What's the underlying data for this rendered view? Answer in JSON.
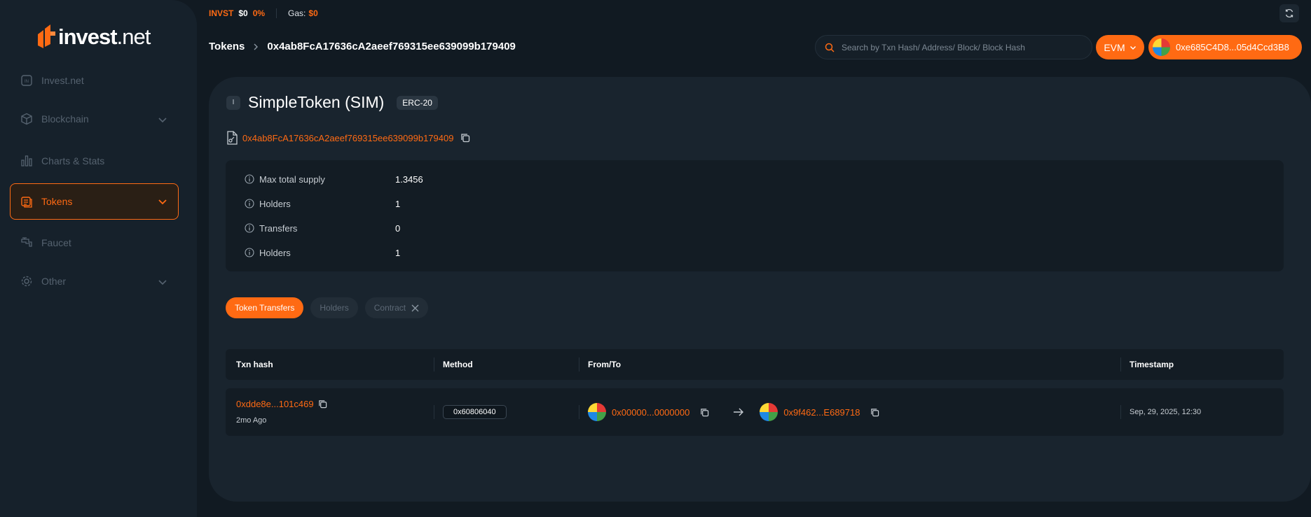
{
  "brand": {
    "name": "invest",
    "tld": ".net",
    "accent": "#ff6a13"
  },
  "topbar": {
    "ticker": "INVST",
    "price": "$0",
    "change": "0%",
    "gas_label": "Gas:",
    "gas_value": "$0"
  },
  "sidebar": {
    "items": [
      {
        "label": "Invest.net",
        "icon": "home-icon"
      },
      {
        "label": "Blockchain",
        "icon": "cube-icon",
        "expandable": true
      },
      {
        "label": "Charts & Stats",
        "icon": "chart-icon"
      },
      {
        "label": "Tokens",
        "icon": "coins-icon",
        "expandable": true,
        "active": true
      },
      {
        "label": "Faucet",
        "icon": "faucet-icon"
      },
      {
        "label": "Other",
        "icon": "gear-icon",
        "expandable": true
      }
    ]
  },
  "breadcrumb": {
    "root": "Tokens",
    "current": "0x4ab8FcA17636cA2aeef769315ee639099b179409"
  },
  "search": {
    "placeholder": "Search by Txn Hash/ Address/ Block/ Block Hash"
  },
  "network": {
    "label": "EVM"
  },
  "wallet": {
    "address": "0xe685C4D8...05d4Ccd3B8"
  },
  "token": {
    "icon_letter": "I",
    "name": "SimpleToken (SIM)",
    "standard": "ERC-20",
    "address": "0x4ab8FcA17636cA2aeef769315ee639099b179409"
  },
  "stats": [
    {
      "label": "Max total supply",
      "value": "1.3456"
    },
    {
      "label": "Holders",
      "value": "1"
    },
    {
      "label": "Transfers",
      "value": "0"
    },
    {
      "label": "Holders",
      "value": "1"
    }
  ],
  "tabs": [
    {
      "label": "Token Transfers",
      "active": true
    },
    {
      "label": "Holders"
    },
    {
      "label": "Contract",
      "closable": true
    }
  ],
  "table": {
    "columns": [
      "Txn hash",
      "Method",
      "From/To",
      "Timestamp"
    ],
    "rows": [
      {
        "hash": "0xdde8e...101c469",
        "age": "2mo Ago",
        "method": "0x60806040",
        "from": "0x00000...0000000",
        "to": "0x9f462...E689718",
        "timestamp": "Sep, 29, 2025, 12:30"
      }
    ]
  }
}
